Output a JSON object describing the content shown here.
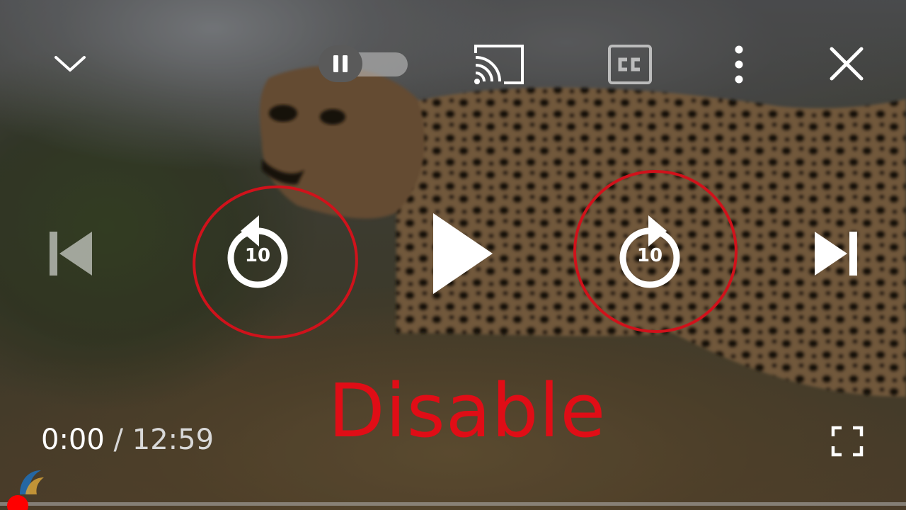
{
  "overlay": {
    "annotation_text": "Disable"
  },
  "time": {
    "current": "0:00",
    "separator": "/",
    "duration": "12:59"
  },
  "progress": {
    "played_fraction": 0.0
  },
  "icons": {
    "minimize": "chevron-down-icon",
    "autoplay": "pause-icon",
    "cast": "cast-icon",
    "captions": "cc-icon",
    "more": "more-vert-icon",
    "close": "close-icon",
    "previous": "skip-previous-icon",
    "rewind": "replay-10-icon",
    "play": "play-icon",
    "forward": "forward-10-icon",
    "next": "skip-next-icon",
    "fullscreen": "fullscreen-icon"
  },
  "seek": {
    "rewind_label": "10",
    "forward_label": "10"
  },
  "colors": {
    "annotation": "#e00d16",
    "progress": "#ff0000",
    "icon": "#ffffff"
  }
}
